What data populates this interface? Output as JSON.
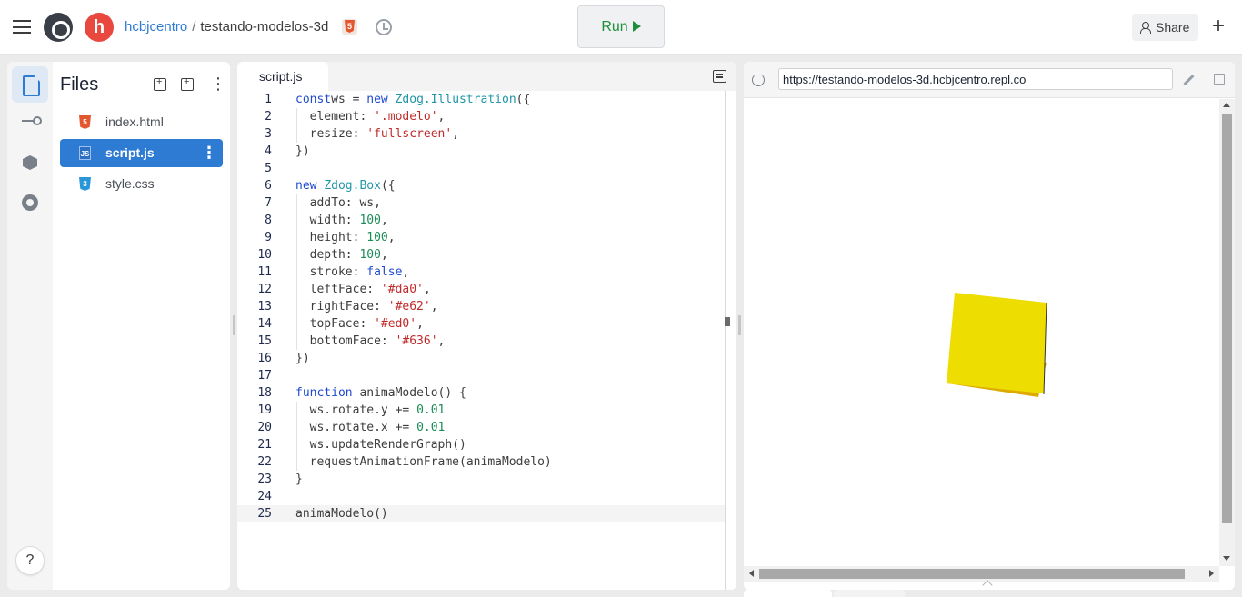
{
  "header": {
    "user": "hcbjcentro",
    "separator": "/",
    "repl_name": "testando-modelos-3d",
    "avatar_letter": "h",
    "run_label": "Run",
    "share_label": "Share",
    "plus_label": "+",
    "avatar_color": "#e8483e",
    "run_color": "#1e8f3b"
  },
  "sidebar": {
    "items": [
      {
        "name": "files",
        "icon": "file-icon",
        "active": true
      },
      {
        "name": "version-control",
        "icon": "git-branch-icon",
        "active": false
      },
      {
        "name": "packages",
        "icon": "package-icon",
        "active": false
      },
      {
        "name": "settings",
        "icon": "gear-icon",
        "active": false
      }
    ],
    "help_label": "?"
  },
  "filetree": {
    "title": "Files",
    "files": [
      {
        "name": "index.html",
        "icon": "html5-icon",
        "selected": false
      },
      {
        "name": "script.js",
        "icon": "js-icon",
        "selected": true
      },
      {
        "name": "style.css",
        "icon": "css3-icon",
        "selected": false
      }
    ],
    "selected_color": "#2e7bd3"
  },
  "editor": {
    "tab": "script.js",
    "current_line": 25,
    "lines": [
      {
        "n": "1",
        "tokens": [
          [
            "kw",
            "const"
          ],
          [
            "",
            "ws = "
          ],
          [
            "kw",
            "new "
          ],
          [
            "cls",
            "Zdog.Illustration"
          ],
          [
            "",
            "({"
          ]
        ]
      },
      {
        "n": "2",
        "tokens": [
          [
            "",
            "  element: "
          ],
          [
            "str",
            "'.modelo'"
          ],
          [
            "",
            ","
          ]
        ]
      },
      {
        "n": "3",
        "tokens": [
          [
            "",
            "  resize: "
          ],
          [
            "str",
            "'fullscreen'"
          ],
          [
            "",
            ","
          ]
        ]
      },
      {
        "n": "4",
        "tokens": [
          [
            "",
            "})"
          ]
        ]
      },
      {
        "n": "5",
        "tokens": []
      },
      {
        "n": "6",
        "tokens": [
          [
            "kw",
            "new "
          ],
          [
            "cls",
            "Zdog.Box"
          ],
          [
            "",
            "({"
          ]
        ]
      },
      {
        "n": "7",
        "tokens": [
          [
            "",
            "  addTo: ws,"
          ]
        ]
      },
      {
        "n": "8",
        "tokens": [
          [
            "",
            "  width: "
          ],
          [
            "num",
            "100"
          ],
          [
            "",
            ","
          ]
        ]
      },
      {
        "n": "9",
        "tokens": [
          [
            "",
            "  height: "
          ],
          [
            "num",
            "100"
          ],
          [
            "",
            ","
          ]
        ]
      },
      {
        "n": "10",
        "tokens": [
          [
            "",
            "  depth: "
          ],
          [
            "num",
            "100"
          ],
          [
            "",
            ","
          ]
        ]
      },
      {
        "n": "11",
        "tokens": [
          [
            "",
            "  stroke: "
          ],
          [
            "bool",
            "false"
          ],
          [
            "",
            ","
          ]
        ]
      },
      {
        "n": "12",
        "tokens": [
          [
            "",
            "  leftFace: "
          ],
          [
            "str",
            "'#da0'"
          ],
          [
            "",
            ","
          ]
        ]
      },
      {
        "n": "13",
        "tokens": [
          [
            "",
            "  rightFace: "
          ],
          [
            "str",
            "'#e62'"
          ],
          [
            "",
            ","
          ]
        ]
      },
      {
        "n": "14",
        "tokens": [
          [
            "",
            "  topFace: "
          ],
          [
            "str",
            "'#ed0'"
          ],
          [
            "",
            ","
          ]
        ]
      },
      {
        "n": "15",
        "tokens": [
          [
            "",
            "  bottomFace: "
          ],
          [
            "str",
            "'#636'"
          ],
          [
            "",
            ","
          ]
        ]
      },
      {
        "n": "16",
        "tokens": [
          [
            "",
            "})"
          ]
        ]
      },
      {
        "n": "17",
        "tokens": []
      },
      {
        "n": "18",
        "tokens": [
          [
            "kw",
            "function "
          ],
          [
            "",
            "animaModelo() {"
          ]
        ]
      },
      {
        "n": "19",
        "tokens": [
          [
            "",
            "  ws.rotate.y += "
          ],
          [
            "num",
            "0.01"
          ]
        ]
      },
      {
        "n": "20",
        "tokens": [
          [
            "",
            "  ws.rotate.x += "
          ],
          [
            "num",
            "0.01"
          ]
        ]
      },
      {
        "n": "21",
        "tokens": [
          [
            "",
            "  ws.updateRenderGraph()"
          ]
        ]
      },
      {
        "n": "22",
        "tokens": [
          [
            "",
            "  requestAnimationFrame(animaModelo)"
          ]
        ]
      },
      {
        "n": "23",
        "tokens": [
          [
            "",
            "}"
          ]
        ]
      },
      {
        "n": "24",
        "tokens": []
      },
      {
        "n": "25",
        "tokens": [
          [
            "",
            "animaModelo()"
          ]
        ]
      }
    ]
  },
  "preview": {
    "url": "https://testando-modelos-3d.hcbjcentro.repl.co",
    "box_colors": {
      "top": "#eedd00",
      "side": "#ddaa00",
      "edge": "#333333"
    }
  }
}
